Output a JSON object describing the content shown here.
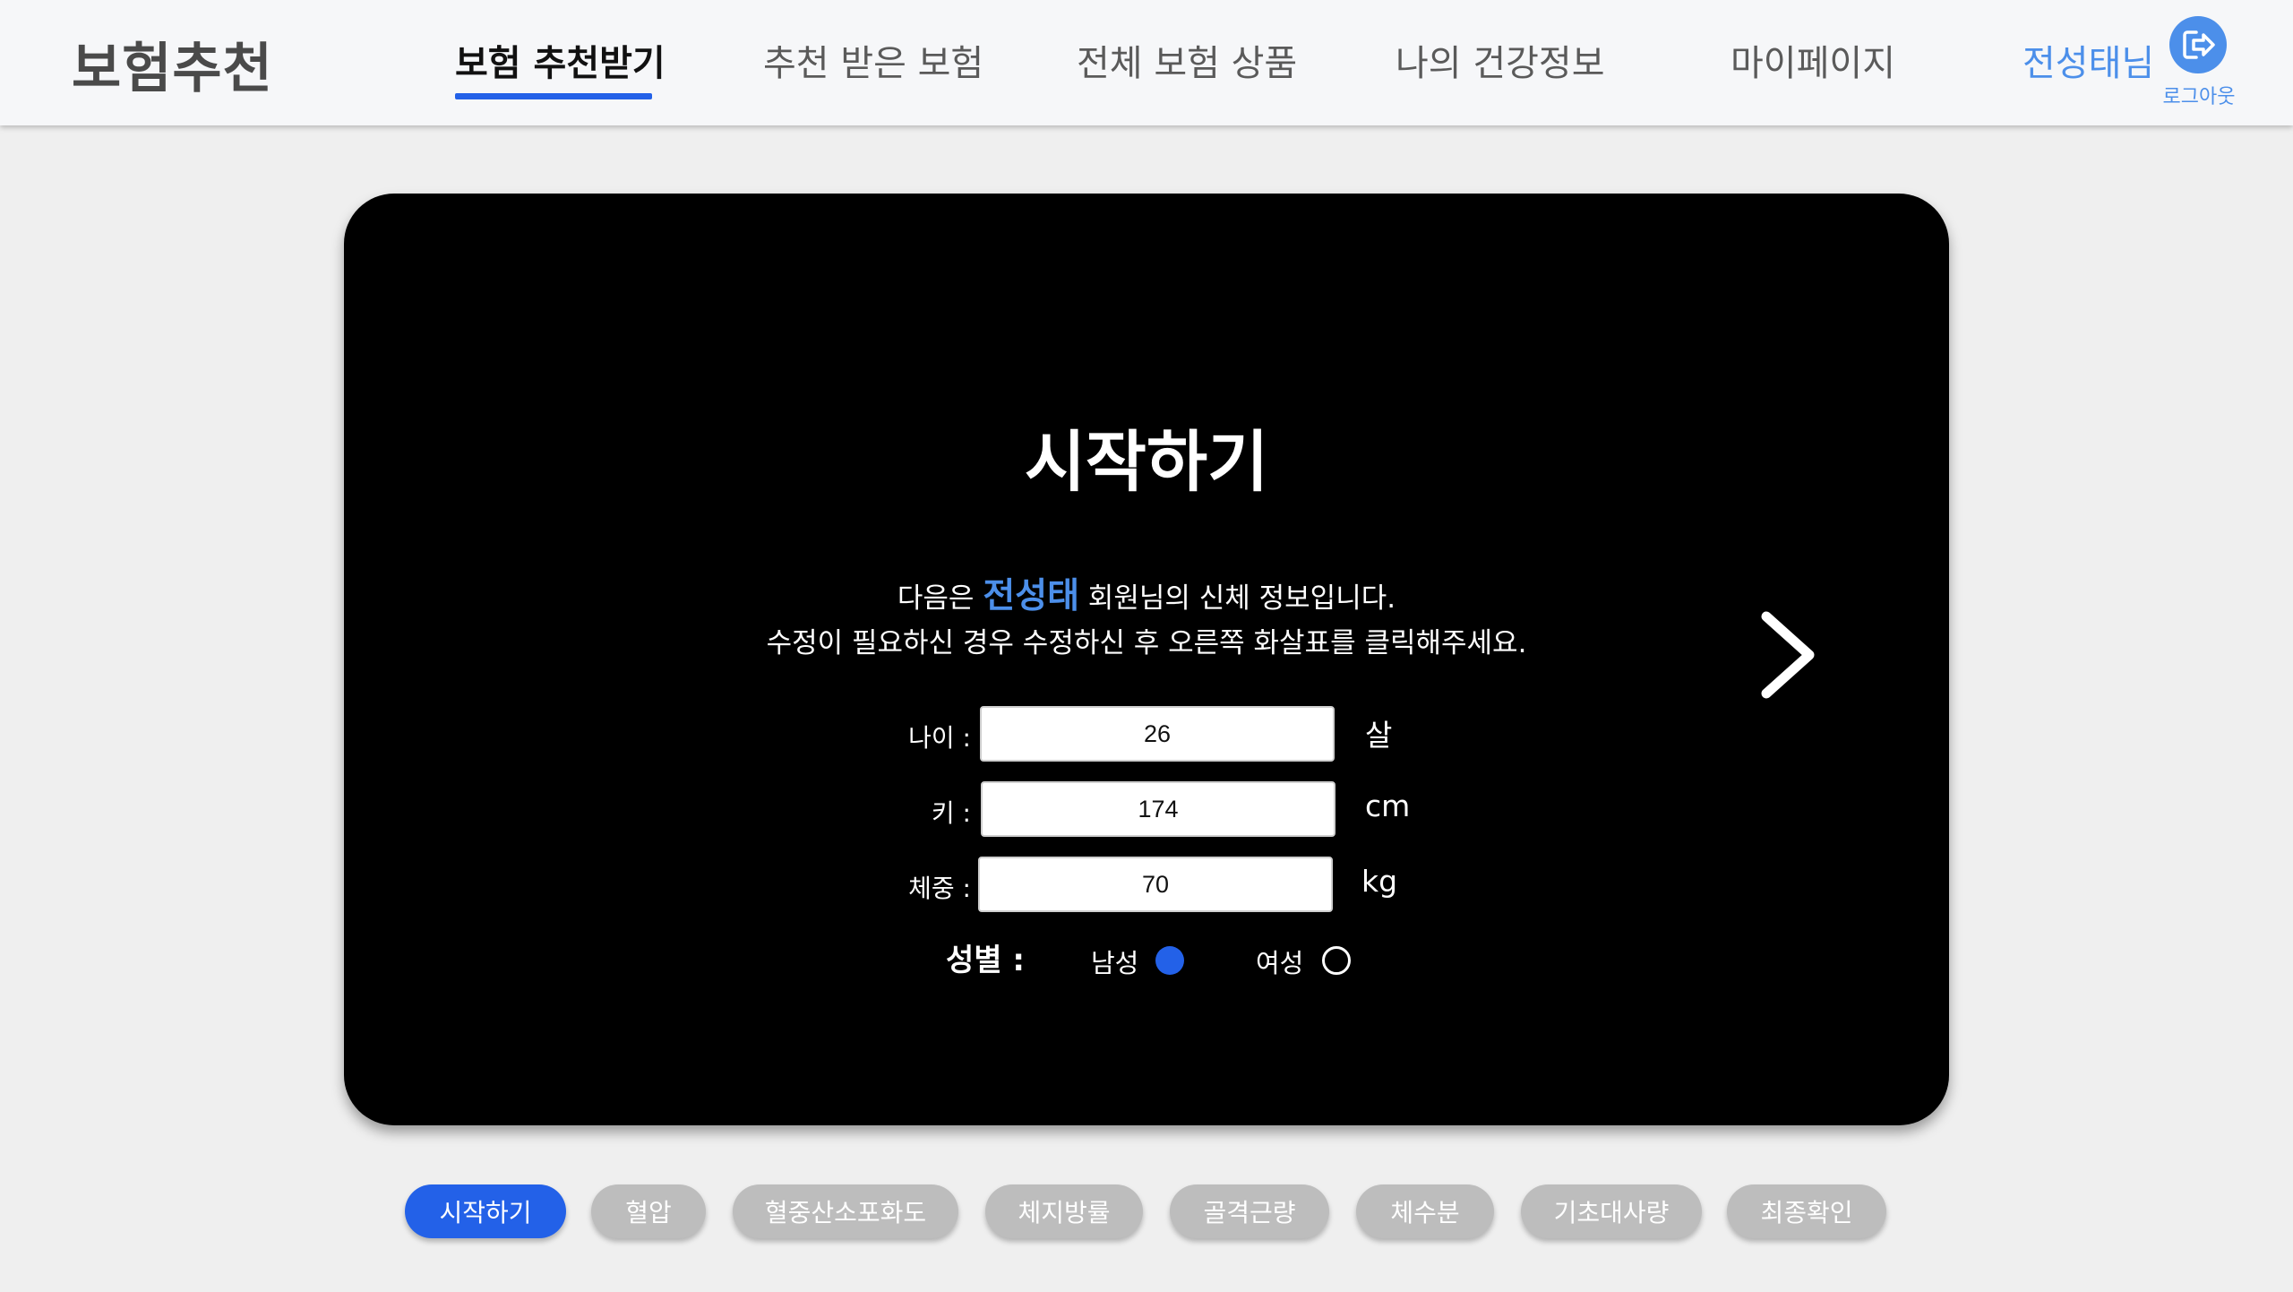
{
  "header": {
    "brand": "보험추천",
    "nav": [
      {
        "label": "보험 추천받기",
        "active": true
      },
      {
        "label": "추천 받은 보험",
        "active": false
      },
      {
        "label": "전체 보험 상품",
        "active": false
      },
      {
        "label": "나의 건강정보",
        "active": false
      },
      {
        "label": "마이페이지",
        "active": false
      }
    ],
    "user_name": "전성태님",
    "logout_label": "로그아웃",
    "logout_icon": "logout-icon"
  },
  "card": {
    "title": "시작하기",
    "desc_prefix": "다음은 ",
    "desc_name": "전성태",
    "desc_suffix": " 회원님의 신체 정보입니다.",
    "desc_line2": "수정이 필요하신 경우 수정하신 후 오른쪽 화살표를 클릭해주세요.",
    "next_icon": "chevron-right-icon",
    "fields": {
      "age": {
        "label": "나이 :",
        "value": "26",
        "unit": "살"
      },
      "height": {
        "label": "키 :",
        "value": "174",
        "unit": "cm"
      },
      "weight": {
        "label": "체중 :",
        "value": "70",
        "unit": "kg"
      }
    },
    "gender": {
      "label": "성별 :",
      "male": "남성",
      "female": "여성",
      "selected": "남성"
    }
  },
  "steps": [
    {
      "label": "시작하기",
      "active": true
    },
    {
      "label": "혈압",
      "active": false
    },
    {
      "label": "혈중산소포화도",
      "active": false
    },
    {
      "label": "체지방률",
      "active": false
    },
    {
      "label": "골격근량",
      "active": false
    },
    {
      "label": "체수분",
      "active": false
    },
    {
      "label": "기초대사량",
      "active": false
    },
    {
      "label": "최종확인",
      "active": false
    }
  ],
  "colors": {
    "accent": "#2361e8",
    "user_accent": "#4c8fea",
    "inactive_pill": "#bdbdbd",
    "card_bg": "#000000"
  }
}
